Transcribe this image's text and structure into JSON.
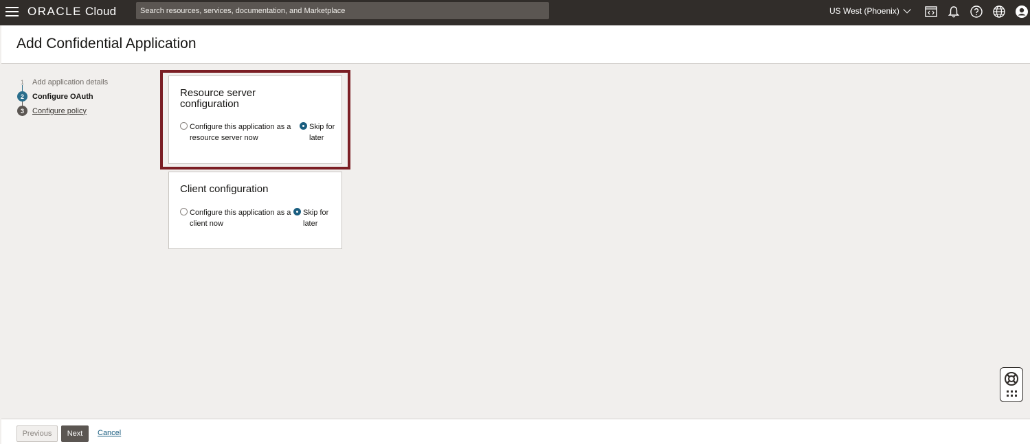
{
  "topbar": {
    "brand": "ORACLE",
    "brand_suffix": "Cloud",
    "search_placeholder": "Search resources, services, documentation, and Marketplace",
    "region": "US West (Phoenix)",
    "icons": [
      "code-editor-icon",
      "bell-icon",
      "help-icon",
      "globe-icon",
      "user-icon"
    ]
  },
  "header": {
    "title": "Add Confidential Application"
  },
  "steps": [
    {
      "num": "1",
      "label": "Add application details",
      "state": "done"
    },
    {
      "num": "2",
      "label": "Configure OAuth",
      "state": "current"
    },
    {
      "num": "3",
      "label": "Configure policy",
      "state": "next"
    }
  ],
  "resource_server": {
    "title": "Resource server configuration",
    "option_configure": "Configure this application as a resource server now",
    "option_skip": "Skip for later",
    "selected": "skip"
  },
  "client_config": {
    "title": "Client configuration",
    "option_configure": "Configure this application as a client now",
    "option_skip": "Skip for later",
    "selected": "skip"
  },
  "footer": {
    "previous": "Previous",
    "next": "Next",
    "cancel": "Cancel"
  },
  "colors": {
    "topbar": "#312d2a",
    "highlight": "#7b1e24",
    "accent": "#2a6e8c",
    "link": "#1b5e80"
  }
}
